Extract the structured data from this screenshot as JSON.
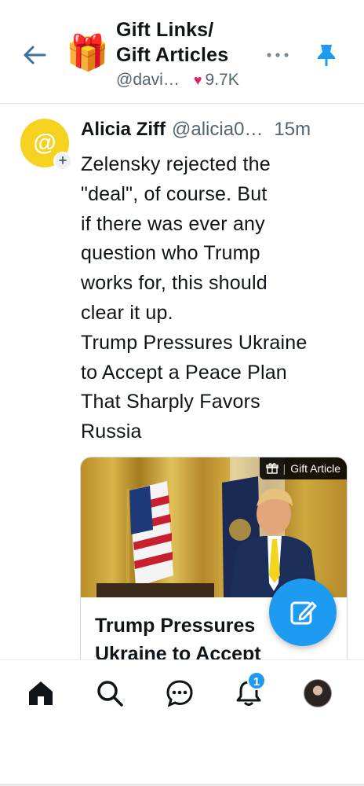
{
  "header": {
    "title_line1": "Gift Links/",
    "title_line2": "Gift Articles",
    "feed_emoji": "🎁",
    "creator": "@davi…",
    "likes": "9.7K",
    "icons": [
      "back-arrow-icon",
      "gift-icon",
      "heart-icon",
      "more-horizontal-icon",
      "pin-icon"
    ]
  },
  "post": {
    "author_name": "Alicia Ziff",
    "author_handle": "@alicia0…",
    "time": "15m",
    "avatar_glyph": "@",
    "text_lines": [
      "Zelensky rejected the",
      "\"deal\", of course. But",
      "if there was ever any",
      "question who Trump",
      "works for, this should",
      "clear it up.",
      "Trump Pressures Ukraine",
      "to Accept a Peace Plan",
      "That Sharply Favors",
      "Russia"
    ],
    "card": {
      "badge_label": "Gift Article",
      "title_line1": "Trump Pressures",
      "title_line2": "Ukraine to Accept"
    }
  },
  "nav": {
    "items": [
      "home-icon",
      "search-icon",
      "chat-icon",
      "bell-icon",
      "profile-avatar"
    ],
    "notification_count": "1"
  },
  "colors": {
    "accent": "#1d9bf0",
    "avatar_yellow": "#f5d21f",
    "heart": "#e0245e",
    "muted_text": "#536471"
  }
}
